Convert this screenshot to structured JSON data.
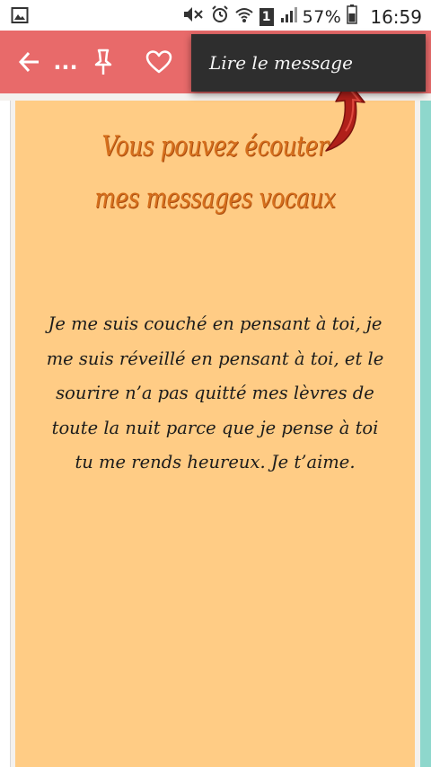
{
  "status_bar": {
    "battery": "57%",
    "sim": "1",
    "time": "16:59"
  },
  "toolbar": {
    "more_label": "...",
    "icons": [
      "back-arrow-icon",
      "pin-icon",
      "heart-icon"
    ]
  },
  "popup_menu": {
    "item": "Lire le message"
  },
  "card": {
    "headline_line1": "Vous pouvez écouter",
    "headline_line2": "mes messages vocaux",
    "message": "Je me suis couché en pensant à toi, je me suis réveillé en pensant à toi, et le sourire n’a pas quitté mes lèvres de toute la nuit parce que je pense à toi tu me rends heureux. Je t’aime."
  },
  "colors": {
    "toolbar": "#e86a6a",
    "card": "#ffcc85",
    "headline": "#d6701d",
    "popup": "#2e2e2e",
    "arrow": "#b0201a",
    "right_strip": "#8ed7cc"
  }
}
